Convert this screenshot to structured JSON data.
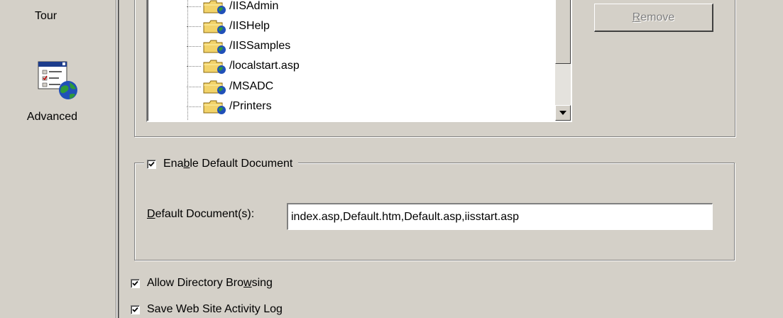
{
  "nav": {
    "tour_label": "Tour",
    "advanced_label": "Advanced",
    "advanced_icon": "advanced-settings-icon"
  },
  "tree": {
    "items": [
      {
        "label": "/IISAdmin",
        "icon": "web-folder-icon"
      },
      {
        "label": "/IISHelp",
        "icon": "web-folder-icon"
      },
      {
        "label": "/IISSamples",
        "icon": "web-folder-icon"
      },
      {
        "label": "/localstart.asp",
        "icon": "web-folder-icon"
      },
      {
        "label": "/MSADC",
        "icon": "web-folder-icon"
      },
      {
        "label": "/Printers",
        "icon": "web-folder-icon"
      }
    ]
  },
  "buttons": {
    "remove_label": "Remove",
    "remove_mnemonic": "R"
  },
  "default_document": {
    "enable_label_pre": "Ena",
    "enable_label_mnemonic": "b",
    "enable_label_post": "le Default Document",
    "enable_checked": true,
    "field_label_mnemonic": "D",
    "field_label_post": "efault Document(s):",
    "field_value": "index.asp,Default.htm,Default.asp,iisstart.asp"
  },
  "options": {
    "dir_browsing_pre": "Allow Directory Bro",
    "dir_browsing_mnemonic": "w",
    "dir_browsing_post": "sing",
    "dir_browsing_checked": true,
    "activity_log_label": "Save Web Site Activity Log",
    "activity_log_checked": true
  },
  "colors": {
    "dialog_bg": "#d4d0c8",
    "disabled_text": "#808080"
  }
}
